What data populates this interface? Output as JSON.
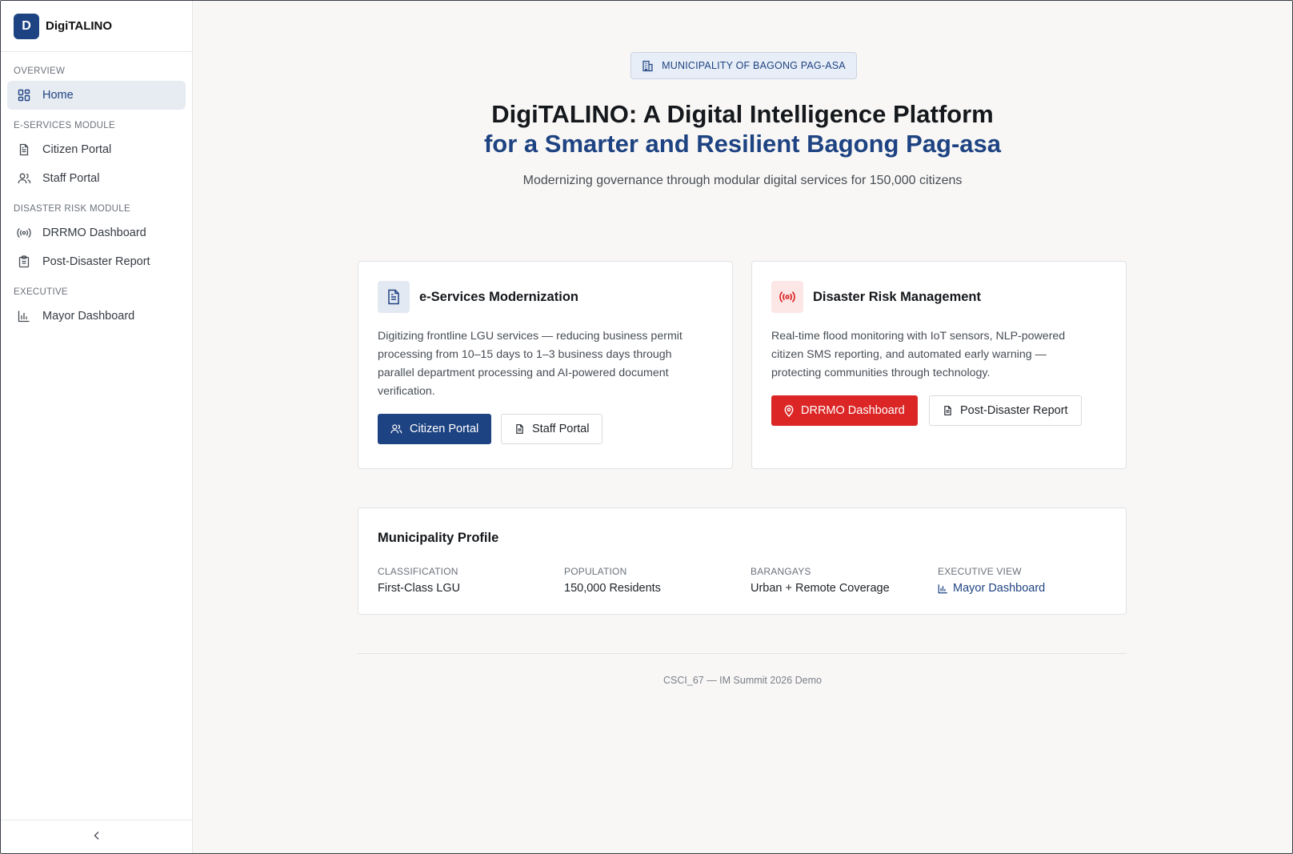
{
  "app": {
    "logo_letter": "D",
    "name": "DigiTALINO"
  },
  "sidebar": {
    "sections": [
      {
        "label": "OVERVIEW",
        "items": [
          {
            "label": "Home",
            "icon": "grid-icon",
            "active": true
          }
        ]
      },
      {
        "label": "E-SERVICES MODULE",
        "items": [
          {
            "label": "Citizen Portal",
            "icon": "document-icon"
          },
          {
            "label": "Staff Portal",
            "icon": "users-icon"
          }
        ]
      },
      {
        "label": "DISASTER RISK MODULE",
        "items": [
          {
            "label": "DRRMO Dashboard",
            "icon": "broadcast-icon"
          },
          {
            "label": "Post-Disaster Report",
            "icon": "clipboard-icon"
          }
        ]
      },
      {
        "label": "EXECUTIVE",
        "items": [
          {
            "label": "Mayor Dashboard",
            "icon": "bar-chart-icon"
          }
        ]
      }
    ],
    "collapse_icon": "chevron-left-icon"
  },
  "hero": {
    "badge": "MUNICIPALITY OF BAGONG PAG-ASA",
    "title_line1": "DigiTALINO: A Digital Intelligence Platform",
    "title_line2": "for a Smarter and Resilient Bagong Pag-asa",
    "subtitle": "Modernizing governance through modular digital services for 150,000 citizens"
  },
  "cards": {
    "eservices": {
      "title": "e-Services Modernization",
      "description": "Digitizing frontline LGU services — reducing business permit processing from 10–15 days to 1–3 business days through parallel department processing and AI-powered document verification.",
      "primary_label": "Citizen Portal",
      "secondary_label": "Staff Portal"
    },
    "disaster": {
      "title": "Disaster Risk Management",
      "description": "Real-time flood monitoring with IoT sensors, NLP-powered citizen SMS reporting, and automated early warning — protecting communities through technology.",
      "primary_label": "DRRMO Dashboard",
      "secondary_label": "Post-Disaster Report"
    }
  },
  "profile": {
    "title": "Municipality Profile",
    "stats": [
      {
        "label": "CLASSIFICATION",
        "value": "First-Class LGU"
      },
      {
        "label": "POPULATION",
        "value": "150,000 Residents"
      },
      {
        "label": "BARANGAYS",
        "value": "Urban + Remote Coverage"
      },
      {
        "label": "EXECUTIVE VIEW",
        "value": "Mayor Dashboard"
      }
    ]
  },
  "footer": {
    "text": "CSCI_67 — IM Summit 2026 Demo"
  },
  "colors": {
    "primary": "#1e4382",
    "danger": "#dc2626",
    "background": "#f8f7f5"
  }
}
